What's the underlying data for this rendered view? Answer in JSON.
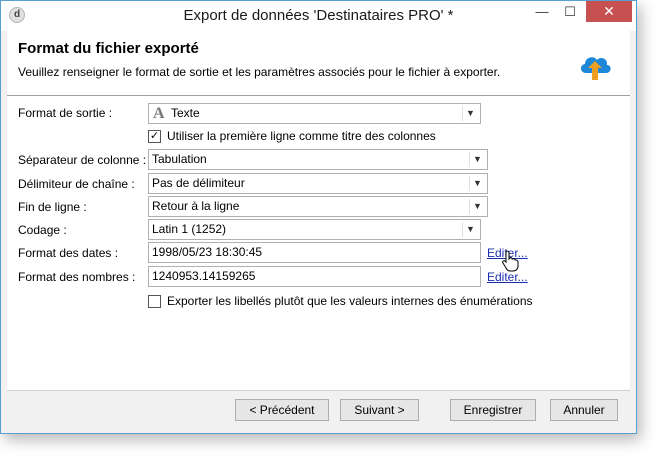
{
  "window": {
    "title": "Export de données 'Destinataires PRO' *",
    "app_icon": "d",
    "minimize": "—",
    "maximize": "☐",
    "close": "✕"
  },
  "header": {
    "title": "Format du fichier exporté",
    "description": "Veuillez renseigner le format de sortie et les paramètres associés pour le fichier à exporter.",
    "icon": "cloud-upload-icon"
  },
  "form": {
    "output_format": {
      "label": "Format de sortie :",
      "value": "Texte",
      "icon_glyph": "A"
    },
    "first_line_titles": {
      "label": "Utiliser la première ligne comme titre des colonnes",
      "checked": true,
      "mark": "✓"
    },
    "column_separator": {
      "label": "Séparateur de colonne :",
      "value": "Tabulation"
    },
    "string_delimiter": {
      "label": "Délimiteur de chaîne :",
      "value": "Pas de délimiteur"
    },
    "line_end": {
      "label": "Fin de ligne :",
      "value": "Retour à la ligne"
    },
    "encoding": {
      "label": "Codage :",
      "value": "Latin 1 (1252)"
    },
    "date_format": {
      "label": "Format des dates :",
      "value": "1998/05/23 18:30:45",
      "edit": "Editer..."
    },
    "number_format": {
      "label": "Format des nombres :",
      "value": "1240953.14159265",
      "edit": "Editer..."
    },
    "export_labels": {
      "label": "Exporter les libellés plutôt que les valeurs internes des énumérations",
      "checked": false,
      "mark": ""
    }
  },
  "footer": {
    "previous": "< Précédent",
    "next": "Suivant >",
    "save": "Enregistrer",
    "cancel": "Annuler"
  },
  "colors": {
    "accent_border": "#5a9fd4",
    "close_button": "#c75050",
    "link": "#1a2fb0",
    "cloud": "#1e88d8",
    "arrow": "#f0a020"
  }
}
